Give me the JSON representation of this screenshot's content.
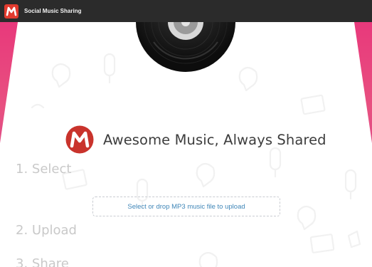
{
  "window": {
    "title": "Social Music Sharing",
    "icon": "m-logo-icon"
  },
  "hero": {
    "tagline": "Awesome Music, Always Shared",
    "logo_icon": "m-logo-icon",
    "vinyl_icon": "vinyl-record-icon"
  },
  "steps": [
    {
      "label": "1. Select"
    },
    {
      "label": "2. Upload"
    },
    {
      "label": "3. Share"
    }
  ],
  "upload": {
    "dropzone_label": "Select or drop MP3 music file to upload"
  },
  "colors": {
    "brand_red": "#c9332c",
    "titlebar": "#2b2b2b",
    "background_pink": "#e8337a",
    "link_blue": "#3f86b8",
    "step_gray": "#c9c9c9"
  }
}
